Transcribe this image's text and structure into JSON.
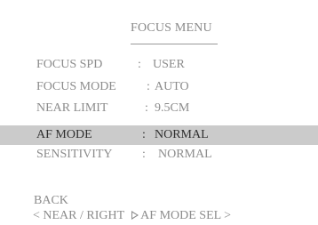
{
  "menu": {
    "title": "FOCUS MENU",
    "rows": [
      {
        "label": "FOCUS SPD",
        "separator": ":",
        "value": "USER",
        "selected": false
      },
      {
        "label": "FOCUS MODE",
        "separator": ":",
        "value": "AUTO",
        "selected": false
      },
      {
        "label": "NEAR LIMIT",
        "separator": ":",
        "value": "9.5CM",
        "selected": false
      },
      {
        "label": "AF MODE",
        "separator": ":",
        "value": "NORMAL",
        "selected": true
      },
      {
        "label": "SENSITIVITY",
        "separator": ":",
        "value": "NORMAL",
        "selected": false
      }
    ]
  },
  "footer": {
    "back_label": "BACK",
    "left_hint": "< NEAR / RIGHT",
    "arrow_icon": "play-triangle-outline-icon",
    "right_hint": "AF MODE SEL >"
  },
  "colors": {
    "background": "#ffffff",
    "text": "#8c8c8c",
    "selected_row_bg": "#cbcbcb",
    "selected_row_text": "#2f2f2f"
  }
}
